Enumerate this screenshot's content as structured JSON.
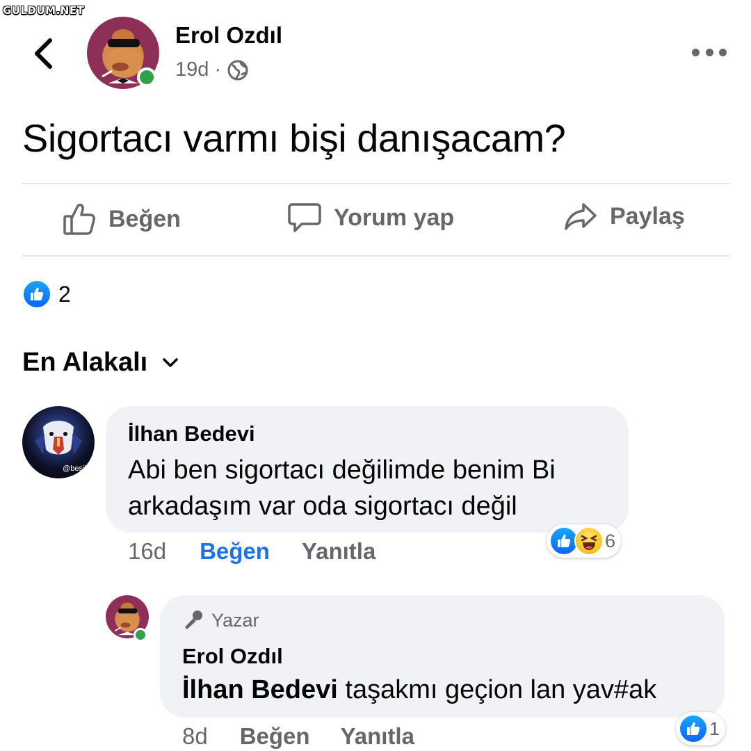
{
  "watermark": "GULDUM.NET",
  "post": {
    "author": "Erol Ozdıl",
    "time": "19d",
    "separator": "·",
    "privacy_icon": "globe-icon",
    "text": "Sigortacı varmı bişi danışacam?",
    "reaction_count": "2"
  },
  "actions": {
    "like": "Beğen",
    "comment": "Yorum yap",
    "share": "Paylaş"
  },
  "sort_label": "En Alakalı",
  "comments": [
    {
      "author": "İlhan Bedevi",
      "avatar_tag": "@besikt",
      "text_line1": "Abi ben sigortacı değilimde benim Bi",
      "text_line2": "arkadaşım var oda sigortacı değil",
      "time": "16d",
      "like": "Beğen",
      "reply": "Yanıtla",
      "reaction_count": "6"
    },
    {
      "badge": "Yazar",
      "author": "Erol Ozdıl",
      "mention": "İlhan Bedevi",
      "text": " taşakmı geçion lan yav#ak",
      "time": "8d",
      "like": "Beğen",
      "reply": "Yanıtla",
      "reaction_count": "1"
    }
  ],
  "colors": {
    "accent": "#1b74e4",
    "secondary_text": "#65676b",
    "bubble": "#f0f2f5",
    "online": "#31a24c"
  }
}
